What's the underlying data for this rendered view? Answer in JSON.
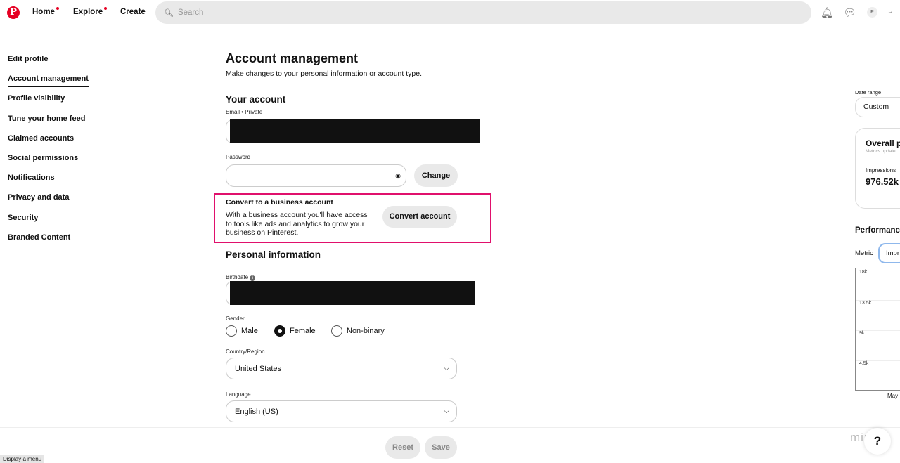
{
  "header": {
    "logo": "P",
    "nav": [
      {
        "label": "Home",
        "notify": true
      },
      {
        "label": "Explore",
        "notify": true
      },
      {
        "label": "Create",
        "notify": false
      }
    ],
    "search_placeholder": "Search",
    "avatar": "P",
    "icons": [
      "bell-icon",
      "chat-icon",
      "chevron-down-icon"
    ]
  },
  "sidebar": {
    "items": [
      {
        "label": "Edit profile"
      },
      {
        "label": "Account management",
        "active": true
      },
      {
        "label": "Profile visibility"
      },
      {
        "label": "Tune your home feed"
      },
      {
        "label": "Claimed accounts"
      },
      {
        "label": "Social permissions"
      },
      {
        "label": "Notifications"
      },
      {
        "label": "Privacy and data"
      },
      {
        "label": "Security"
      },
      {
        "label": "Branded Content"
      }
    ]
  },
  "main": {
    "title": "Account management",
    "subtitle": "Make changes to your personal information or account type.",
    "your_account": "Your account",
    "email_label": "Email • Private",
    "password_label": "Password",
    "change": "Change",
    "business": {
      "title": "Convert to a business account",
      "text": "With a business account you'll have access to tools like ads and analytics to grow your business on Pinterest.",
      "button": "Convert account",
      "highlight_color": "#e0106c"
    },
    "personal": "Personal information",
    "birthdate_label": "Birthdate",
    "gender_label": "Gender",
    "genders": [
      {
        "label": "Male",
        "selected": false
      },
      {
        "label": "Female",
        "selected": true
      },
      {
        "label": "Non-binary",
        "selected": false
      }
    ],
    "country_label": "Country/Region",
    "country": "United States",
    "language_label": "Language",
    "language": "English (US)"
  },
  "footer": {
    "reset": "Reset",
    "save": "Save",
    "status": "Display a menu"
  },
  "right": {
    "date_range_label": "Date range",
    "date_range": "Custom",
    "overall": "Overall p",
    "metrics_updated": "Metrics update",
    "impressions_label": "Impressions",
    "impressions": "976.52k",
    "performance": "Performanc",
    "metric_label": "Metric",
    "metric": "Impr",
    "ticks": [
      "18k",
      "13.5k",
      "9k",
      "4.5k"
    ],
    "xlabel": "May",
    "watermark": "miro",
    "help": "?"
  }
}
